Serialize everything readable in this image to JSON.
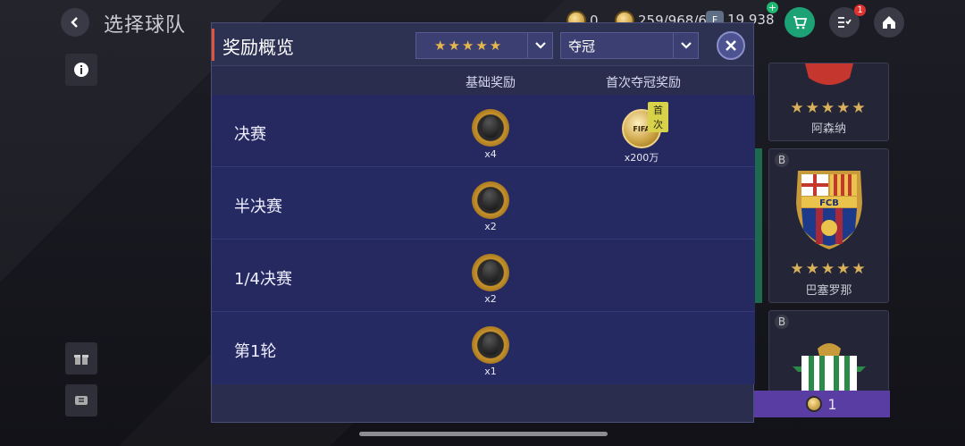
{
  "topbar": {
    "title": "选择球队",
    "currency_a": "0",
    "currency_b": "259/968/68",
    "currency_c": "19,938",
    "fc_label": "F",
    "tasks_badge": "1"
  },
  "modal": {
    "title": "奖励概览",
    "stars_value": "★★★★★",
    "result_value": "夺冠",
    "col_base": "基础奖励",
    "col_first": "首次夺冠奖励",
    "first_badge": "首次",
    "coin_label": "FIFA",
    "rows": [
      {
        "label": "决赛",
        "base_qty": "x4",
        "first_qty": "x200万"
      },
      {
        "label": "半决赛",
        "base_qty": "x2",
        "first_qty": ""
      },
      {
        "label": "1/4决赛",
        "base_qty": "x2",
        "first_qty": ""
      },
      {
        "label": "第1轮",
        "base_qty": "x1",
        "first_qty": ""
      }
    ]
  },
  "teams": {
    "card1": {
      "stars": "★★★★★",
      "name": "阿森纳"
    },
    "card2": {
      "tier": "B",
      "stars": "★★★★★",
      "name": "巴塞罗那",
      "crest": "FCB"
    },
    "card3": {
      "tier": "B"
    },
    "bottom_count": "1"
  },
  "colors": {
    "accent": "#e2543a",
    "modal_bg": "#252960",
    "gold": "#d9b15a"
  }
}
